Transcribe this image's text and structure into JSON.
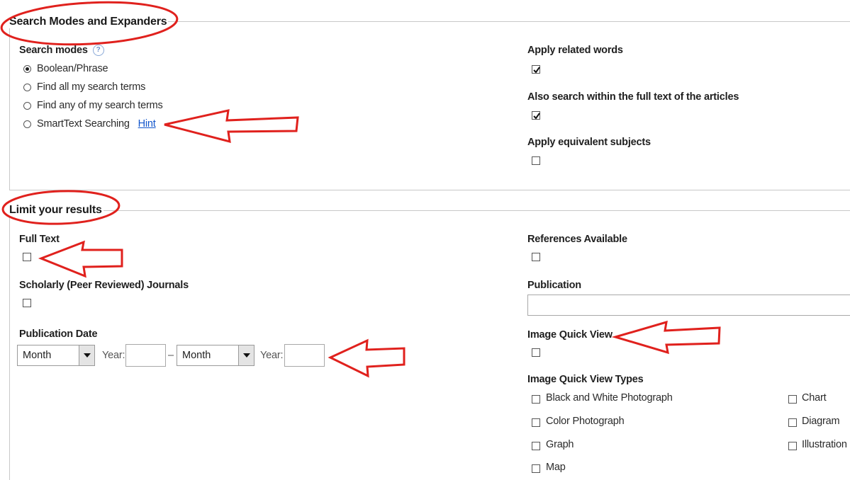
{
  "search_modes_section": {
    "legend": "Search Modes and Expanders",
    "modes_label": "Search modes",
    "modes": [
      {
        "label": "Boolean/Phrase",
        "selected": true
      },
      {
        "label": "Find all my search terms",
        "selected": false
      },
      {
        "label": "Find any of my search terms",
        "selected": false
      },
      {
        "label": "SmartText Searching",
        "selected": false
      }
    ],
    "hint_link": "Hint",
    "expanders": [
      {
        "label": "Apply related words",
        "checked": true
      },
      {
        "label": "Also search within the full text of the articles",
        "checked": true
      },
      {
        "label": "Apply equivalent subjects",
        "checked": false
      }
    ]
  },
  "limit_section": {
    "legend": "Limit your results",
    "full_text_label": "Full Text",
    "scholarly_label": "Scholarly (Peer Reviewed) Journals",
    "pub_date_label": "Publication Date",
    "month_from": "Month",
    "year_from_label": "Year:",
    "year_from_value": "",
    "dash": "–",
    "month_to": "Month",
    "year_to_label": "Year:",
    "year_to_value": "",
    "references_label": "References Available",
    "publication_label": "Publication",
    "publication_value": "",
    "iqv_label": "Image Quick View",
    "iqv_types_label": "Image Quick View Types",
    "iqv_types": [
      "Black and White Photograph",
      "Chart",
      "Color Photograph",
      "Diagram",
      "Graph",
      "Illustration",
      "Map"
    ]
  },
  "annotation_color": "#e0211d"
}
